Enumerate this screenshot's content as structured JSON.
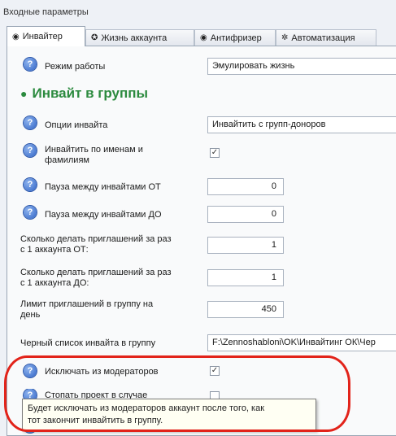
{
  "group_title": "Входные параметры",
  "tabs": [
    {
      "label": "Инвайтер",
      "icon": "radio-icon",
      "active": true
    },
    {
      "label": "Жизнь аккаунта",
      "icon": "life-icon",
      "active": false
    },
    {
      "label": "Антифризер",
      "icon": "radio-icon",
      "active": false
    },
    {
      "label": "Автоматизация",
      "icon": "gear-icon",
      "active": false
    }
  ],
  "form": {
    "mode_label": "Режим работы",
    "mode_value": "Эмулировать жизнь",
    "section_title": "Инвайт в группы",
    "invite_options_label": "Опции инвайта",
    "invite_options_value": "Инвайтить с групп-доноров",
    "by_names_label_1": "Инвайтить по именам и",
    "by_names_label_2": "фамилиям",
    "by_names_checked": "✓",
    "pause_from_label": "Пауза между инвайтами ОТ",
    "pause_from_value": "0",
    "pause_to_label": "Пауза между инвайтами ДО",
    "pause_to_value": "0",
    "invites_from_label_1": "Сколько делать приглашений за раз",
    "invites_from_label_2": "с 1 аккаунта ОТ:",
    "invites_from_value": "1",
    "invites_to_label_1": "Сколько делать приглашений за раз",
    "invites_to_label_2": "с 1 аккаунта ДО:",
    "invites_to_value": "1",
    "limit_label_1": "Лимит приглашений в группу на",
    "limit_label_2": "день",
    "limit_value": "450",
    "blacklist_label": "Черный список инвайта в группу",
    "blacklist_value": "F:\\Zennoshabloni\\OK\\Инвайтинг ОК\\Чер",
    "exclude_mods_label": "Исключать из модераторов",
    "exclude_mods_checked": "✓",
    "stop_project_label": "Стопать проект в случае"
  },
  "tooltip": {
    "line1": "Будет исключать из модераторов аккаунт после того, как",
    "line2": "тот закончит инвайтить в группу."
  },
  "colors": {
    "section_green": "#2b8a3e",
    "help_blue": "#2f63c6",
    "annotation_red": "#e2231a"
  }
}
